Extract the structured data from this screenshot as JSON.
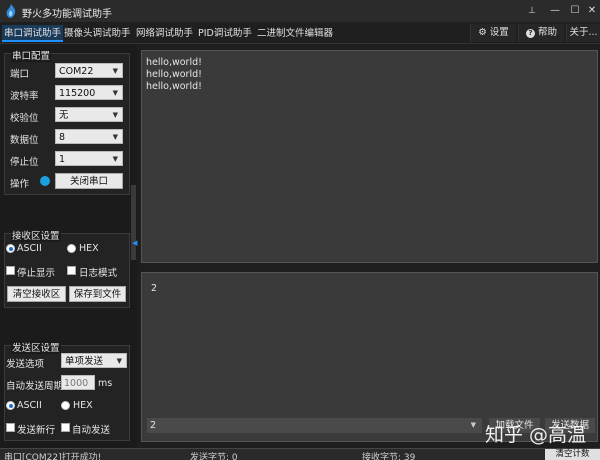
{
  "window": {
    "title": "野火多功能调试助手",
    "pin_glyph": "📌",
    "min_glyph": "—",
    "max_glyph": "☐",
    "close_glyph": "✕"
  },
  "tabs": [
    {
      "label": "串口调试助手",
      "active": true
    },
    {
      "label": "摄像头调试助手",
      "active": false
    },
    {
      "label": "网络调试助手",
      "active": false
    },
    {
      "label": "PID调试助手",
      "active": false
    },
    {
      "label": "二进制文件编辑器",
      "active": false
    }
  ],
  "menu": {
    "settings_icon": "⚙",
    "settings_label": "设置",
    "help_icon": "?",
    "help_label": "帮助",
    "about_label": "关于..."
  },
  "serial_config": {
    "title": "串口配置",
    "port_label": "端口",
    "port_value": "COM22",
    "baud_label": "波特率",
    "baud_value": "115200",
    "parity_label": "校验位",
    "parity_value": "无",
    "databits_label": "数据位",
    "databits_value": "8",
    "stopbits_label": "停止位",
    "stopbits_value": "1",
    "operation_label": "操作",
    "close_port_label": "关闭串口"
  },
  "receive_settings": {
    "title": "接收区设置",
    "ascii_label": "ASCII",
    "hex_label": "HEX",
    "selected_format": "ASCII",
    "stop_display_label": "停止显示",
    "log_mode_label": "日志模式",
    "clear_label": "清空接收区",
    "save_label": "保存到文件"
  },
  "send_settings": {
    "title": "发送区设置",
    "send_option_label": "发送选项",
    "send_option_value": "单项发送",
    "auto_period_label": "自动发送周期",
    "auto_period_value": "1000",
    "auto_period_unit": "ms",
    "ascii_label": "ASCII",
    "hex_label": "HEX",
    "selected_format": "ASCII",
    "send_newline_label": "发送新行",
    "auto_send_label": "自动发送"
  },
  "receive_area": {
    "text": "hello,world!\nhello,world!\nhello,world!"
  },
  "send_area": {
    "text": "2",
    "history_value": "2",
    "load_file_label": "加载文件",
    "send_data_label": "发送数据"
  },
  "status": {
    "message": "串口[COM22]打开成功!",
    "sent_bytes": "发送字节: 0",
    "recv_bytes": "接收字节: 39",
    "clear_count_label": "清空计数"
  },
  "watermark": "知乎 @高温",
  "colors": {
    "accent": "#1e90ff",
    "led": "#19a0e0"
  }
}
